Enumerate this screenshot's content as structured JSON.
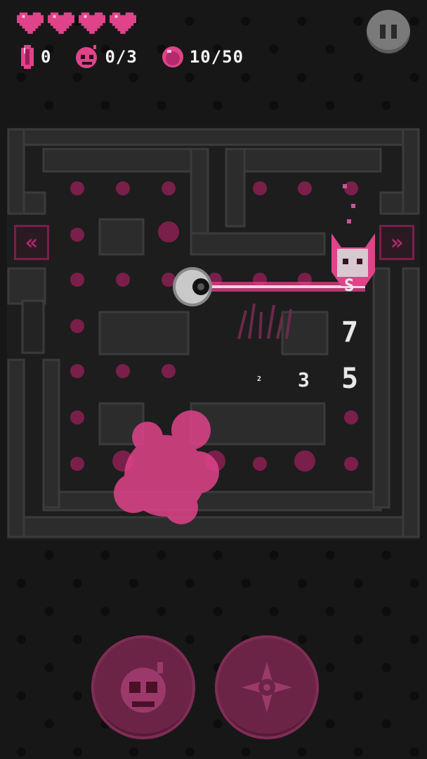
{
  "hud": {
    "hearts": 4,
    "gems": "0",
    "skull_kills": "0/3",
    "orbs": "10/50"
  },
  "floating_numbers": {
    "n1": "S",
    "n2": "7",
    "n3": "3",
    "n4": "5",
    "n5": "2"
  },
  "colors": {
    "accent": "#e0438a",
    "accent_dark": "#6b2446",
    "wall": "#2c2c2c",
    "background": "#171717"
  },
  "icons": {
    "heart": "heart-icon",
    "gem": "gem-icon",
    "skull": "skull-bomb-icon",
    "orb": "orb-icon",
    "pause": "pause-icon",
    "left_nav": "double-chevron-left-icon",
    "right_nav": "double-chevron-right-icon",
    "ability_1": "skull-bomb-icon",
    "ability_2": "shuriken-icon"
  },
  "nav": {
    "left": "«",
    "right": "»"
  }
}
